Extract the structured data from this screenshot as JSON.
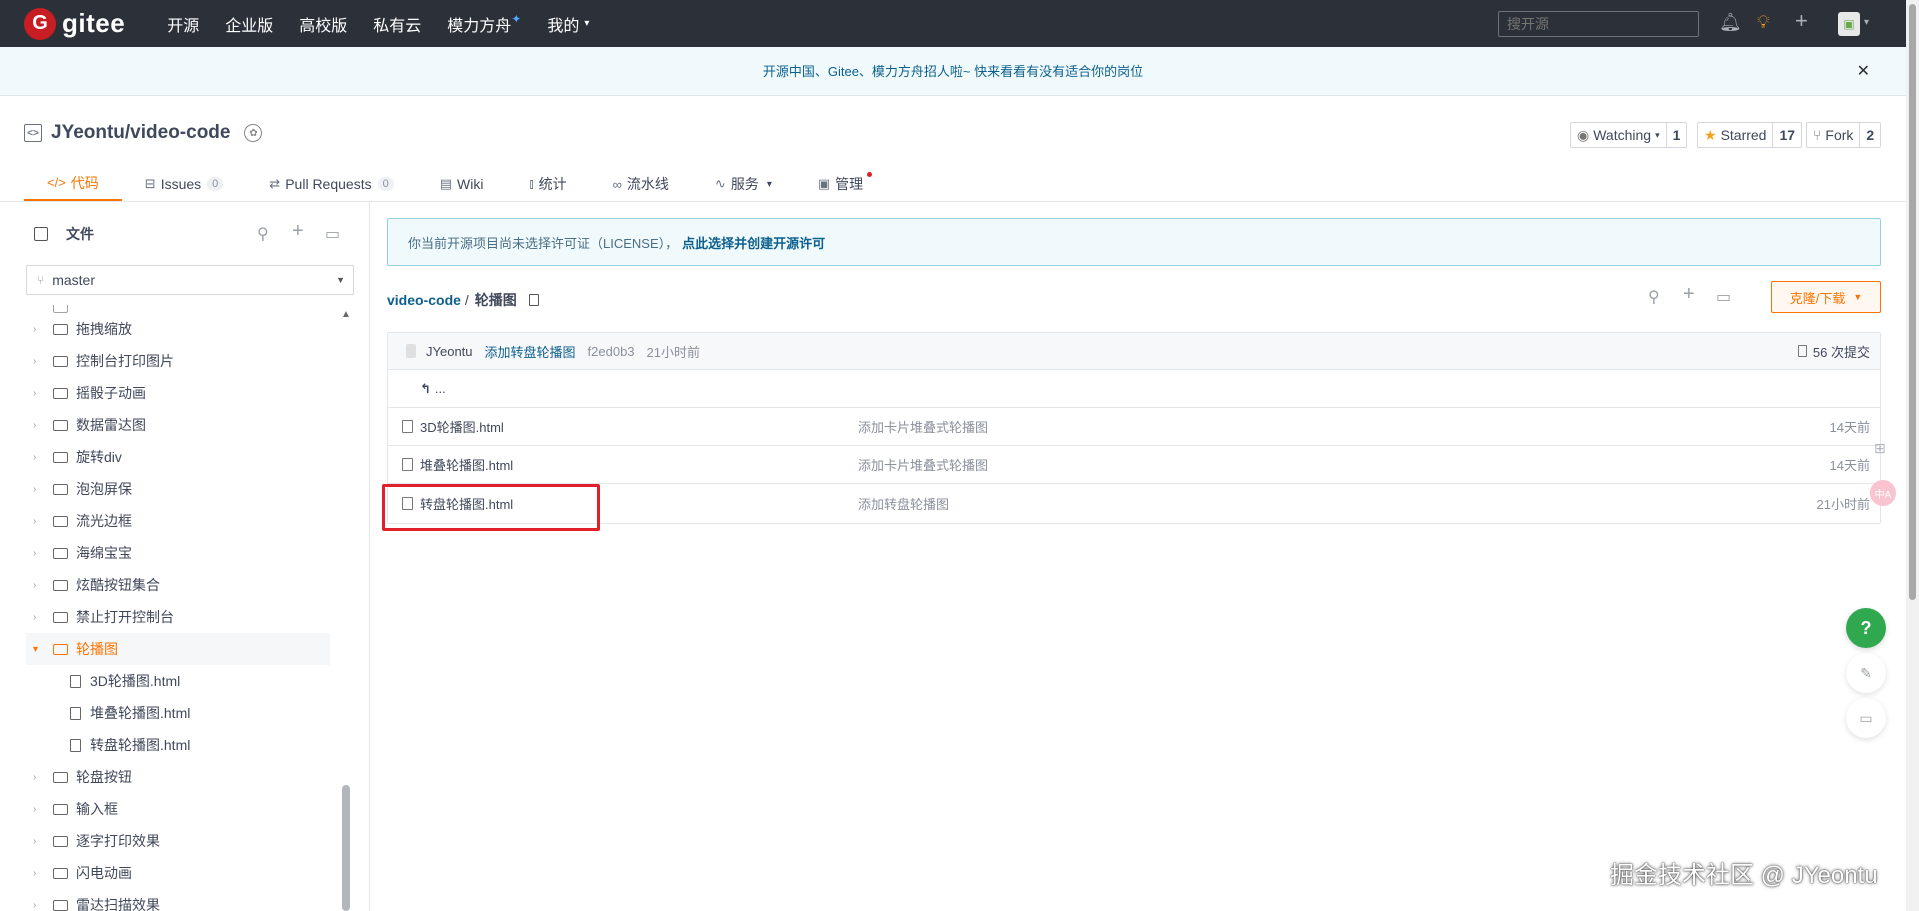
{
  "topnav": {
    "logo_mark": "G",
    "logo_text": "gitee",
    "items": [
      {
        "label": "开源"
      },
      {
        "label": "企业版"
      },
      {
        "label": "高校版"
      },
      {
        "label": "私有云"
      },
      {
        "label": "模力方舟"
      },
      {
        "label": "我的"
      }
    ],
    "spark": "✦",
    "search_placeholder": "搜开源"
  },
  "banner": {
    "text": "开源中国、Gitee、模力方舟招人啦~ 快来看看有没有适合你的岗位",
    "close": "✕"
  },
  "repo": {
    "title": "JYeontu/video-code",
    "watching_label": "Watching",
    "watching_count": "1",
    "starred_label": "Starred",
    "starred_count": "17",
    "fork_label": "Fork",
    "fork_count": "2"
  },
  "tabs": [
    {
      "label": "代码",
      "icon": "</>"
    },
    {
      "label": "Issues",
      "icon": "⊟",
      "count": "0"
    },
    {
      "label": "Pull Requests",
      "icon": "⇄",
      "count": "0"
    },
    {
      "label": "Wiki",
      "icon": "▤"
    },
    {
      "label": "统计",
      "icon": "⫾"
    },
    {
      "label": "流水线",
      "icon": "∞"
    },
    {
      "label": "服务",
      "icon": "∿"
    },
    {
      "label": "管理",
      "icon": "▣"
    }
  ],
  "sidebar": {
    "title": "文件",
    "branch": "master",
    "tree": [
      {
        "label": "拖拽缩放",
        "type": "folder"
      },
      {
        "label": "控制台打印图片",
        "type": "folder"
      },
      {
        "label": "摇骰子动画",
        "type": "folder"
      },
      {
        "label": "数据雷达图",
        "type": "folder"
      },
      {
        "label": "旋转div",
        "type": "folder"
      },
      {
        "label": "泡泡屏保",
        "type": "folder"
      },
      {
        "label": "流光边框",
        "type": "folder"
      },
      {
        "label": "海绵宝宝",
        "type": "folder"
      },
      {
        "label": "炫酷按钮集合",
        "type": "folder"
      },
      {
        "label": "禁止打开控制台",
        "type": "folder"
      },
      {
        "label": "轮播图",
        "type": "folder-open"
      },
      {
        "label": "3D轮播图.html",
        "type": "file"
      },
      {
        "label": "堆叠轮播图.html",
        "type": "file"
      },
      {
        "label": "转盘轮播图.html",
        "type": "file"
      },
      {
        "label": "轮盘按钮",
        "type": "folder"
      },
      {
        "label": "输入框",
        "type": "folder"
      },
      {
        "label": "逐字打印效果",
        "type": "folder"
      },
      {
        "label": "闪电动画",
        "type": "folder"
      },
      {
        "label": "雷达扫描效果",
        "type": "folder"
      }
    ]
  },
  "license": {
    "text": "你当前开源项目尚未选择许可证（LICENSE），",
    "link": "点此选择并创建开源许可"
  },
  "breadcrumb": {
    "repo": "video-code",
    "sep": "/",
    "current": "轮播图"
  },
  "clone_button": "克隆/下载",
  "commit": {
    "author": "JYeontu",
    "message": "添加转盘轮播图",
    "sha": "f2ed0b3",
    "time": "21小时前",
    "commits": "56 次提交"
  },
  "back_label": "...",
  "files": [
    {
      "name": "3D轮播图.html",
      "message": "添加卡片堆叠式轮播图",
      "time": "14天前"
    },
    {
      "name": "堆叠轮播图.html",
      "message": "添加卡片堆叠式轮播图",
      "time": "14天前"
    },
    {
      "name": "转盘轮播图.html",
      "message": "添加转盘轮播图",
      "time": "21小时前"
    }
  ],
  "fab_help": "?",
  "side_pink": "中A",
  "watermark": "掘金技术社区 @ JYeontu",
  "colors": {
    "accent": "#fe7300",
    "nav_bg": "#2b3039",
    "link": "#0c5f8e",
    "highlight": "#e0202b"
  }
}
